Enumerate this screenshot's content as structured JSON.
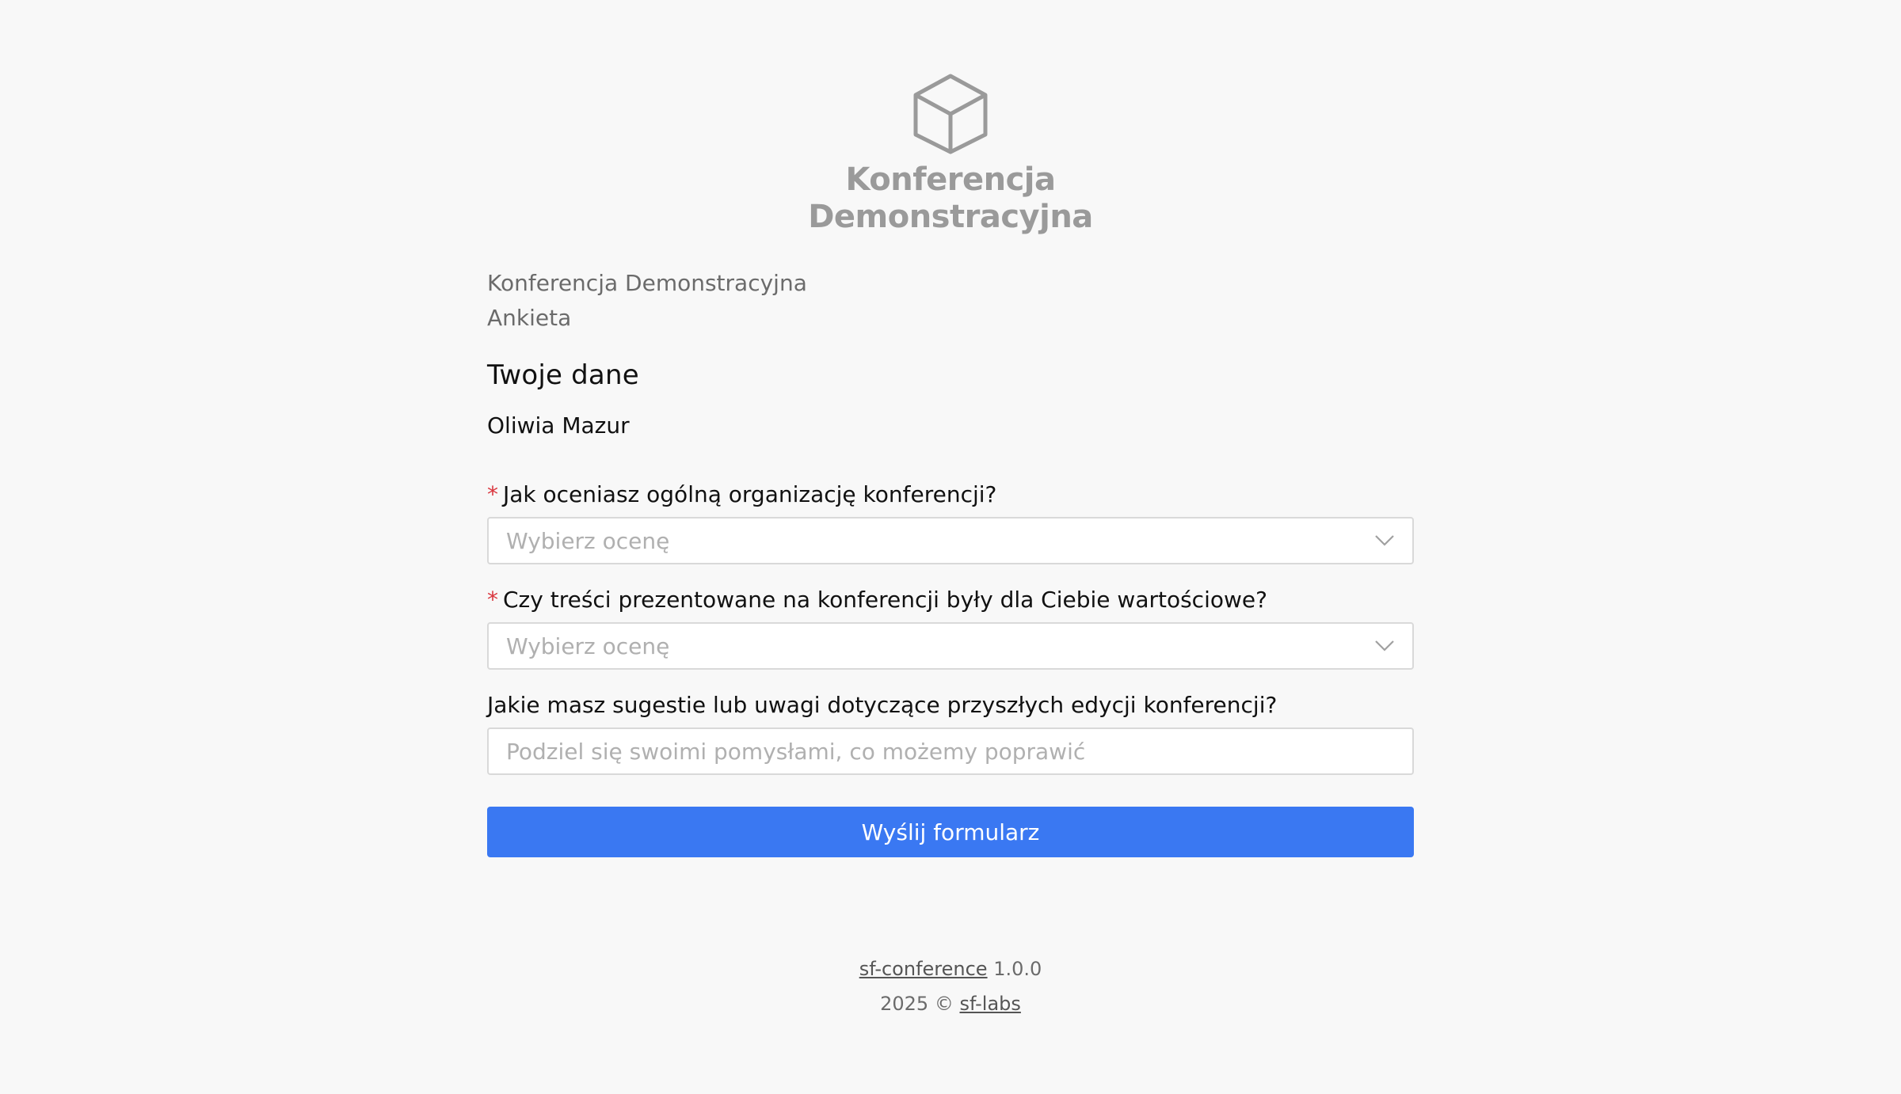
{
  "logo": {
    "icon": "cube-icon",
    "line1": "Konferencja",
    "line2": "Demonstracyjna"
  },
  "header": {
    "conference_name": "Konferencja Demonstracyjna",
    "form_type": "Ankieta"
  },
  "section": {
    "title": "Twoje dane",
    "user_name": "Oliwia Mazur"
  },
  "fields": [
    {
      "required_marker": "*",
      "label": "Jak oceniasz ogólną organizację konferencji?",
      "placeholder": "Wybierz ocenę",
      "icon": "chevron-down-icon"
    },
    {
      "required_marker": "*",
      "label": "Czy treści prezentowane na konferencji były dla Ciebie wartościowe?",
      "placeholder": "Wybierz ocenę",
      "icon": "chevron-down-icon"
    },
    {
      "label": "Jakie masz sugestie lub uwagi dotyczące przyszłych edycji konferencji?",
      "placeholder": "Podziel się swoimi pomysłami, co możemy poprawić"
    }
  ],
  "submit_label": "Wyślij formularz",
  "footer": {
    "app_link": "sf-conference",
    "version": "1.0.0",
    "year_copy": "2025 ©",
    "company_link": "sf-labs"
  },
  "colors": {
    "background": "#f8f8f8",
    "primary": "#3a78f2",
    "required": "#d9363e",
    "logo": "#9a9a9a"
  }
}
